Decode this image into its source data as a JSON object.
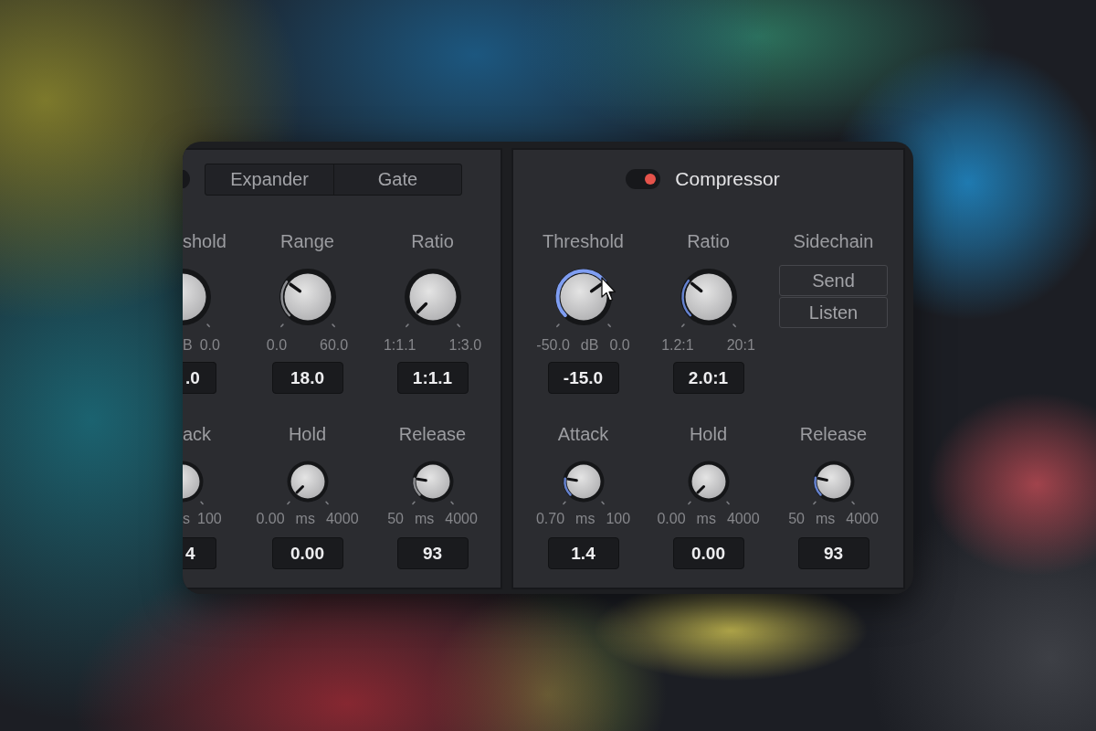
{
  "panels": [
    {
      "toggle": {
        "kind": "clipped",
        "on": false
      },
      "mode_tabs": [
        {
          "label": "Expander",
          "selected": false
        },
        {
          "label": "Gate",
          "selected": false
        }
      ],
      "rows": [
        [
          {
            "kind": "clipped_knob",
            "label": "shold",
            "unit": "B",
            "max": "0.0",
            "value": ".0"
          },
          {
            "kind": "knob",
            "label": "Range",
            "level": 0.3,
            "hovered": false,
            "min": "0.0",
            "max": "60.0",
            "value": "18.0"
          },
          {
            "kind": "knob",
            "label": "Ratio",
            "level": 0,
            "hovered": false,
            "min": "1:1.1",
            "max": "1:3.0",
            "value": "1:1.1"
          }
        ],
        [
          {
            "kind": "clipped_knob",
            "label": "ack",
            "unit": "s",
            "max": "100",
            "value": "4"
          },
          {
            "kind": "knob",
            "label": "Hold",
            "level": 0,
            "hovered": false,
            "min": "0.00",
            "unit": "ms",
            "max": "4000",
            "value": "0.00"
          },
          {
            "kind": "knob",
            "label": "Release",
            "level": 0.2,
            "hovered": false,
            "min": "50",
            "unit": "ms",
            "max": "4000",
            "value": "93"
          }
        ]
      ]
    },
    {
      "toggle": {
        "kind": "full",
        "on": true
      },
      "title": "Compressor",
      "rows": [
        [
          {
            "kind": "knob",
            "label": "Threshold",
            "level": 0.7,
            "hovered": true,
            "min": "-50.0",
            "unit": "dB",
            "max": "0.0",
            "value": "-15.0"
          },
          {
            "kind": "knob",
            "label": "Ratio",
            "level": 0.31,
            "hovered": false,
            "min": "1.2:1",
            "max": "20:1",
            "value": "2.0:1"
          },
          {
            "kind": "button_stack",
            "label": "Sidechain",
            "buttons": [
              {
                "label": "Send",
                "on": false
              },
              {
                "label": "Listen",
                "on": false
              }
            ]
          }
        ],
        [
          {
            "kind": "knob",
            "label": "Attack",
            "level": 0.2,
            "hovered": false,
            "min": "0.70",
            "unit": "ms",
            "max": "100",
            "value": "1.4"
          },
          {
            "kind": "knob",
            "label": "Hold",
            "level": 0,
            "hovered": false,
            "min": "0.00",
            "unit": "ms",
            "max": "4000",
            "value": "0.00"
          },
          {
            "kind": "knob",
            "label": "Release",
            "level": 0.21,
            "hovered": false,
            "min": "50",
            "unit": "ms",
            "max": "4000",
            "value": "93"
          }
        ]
      ]
    }
  ]
}
